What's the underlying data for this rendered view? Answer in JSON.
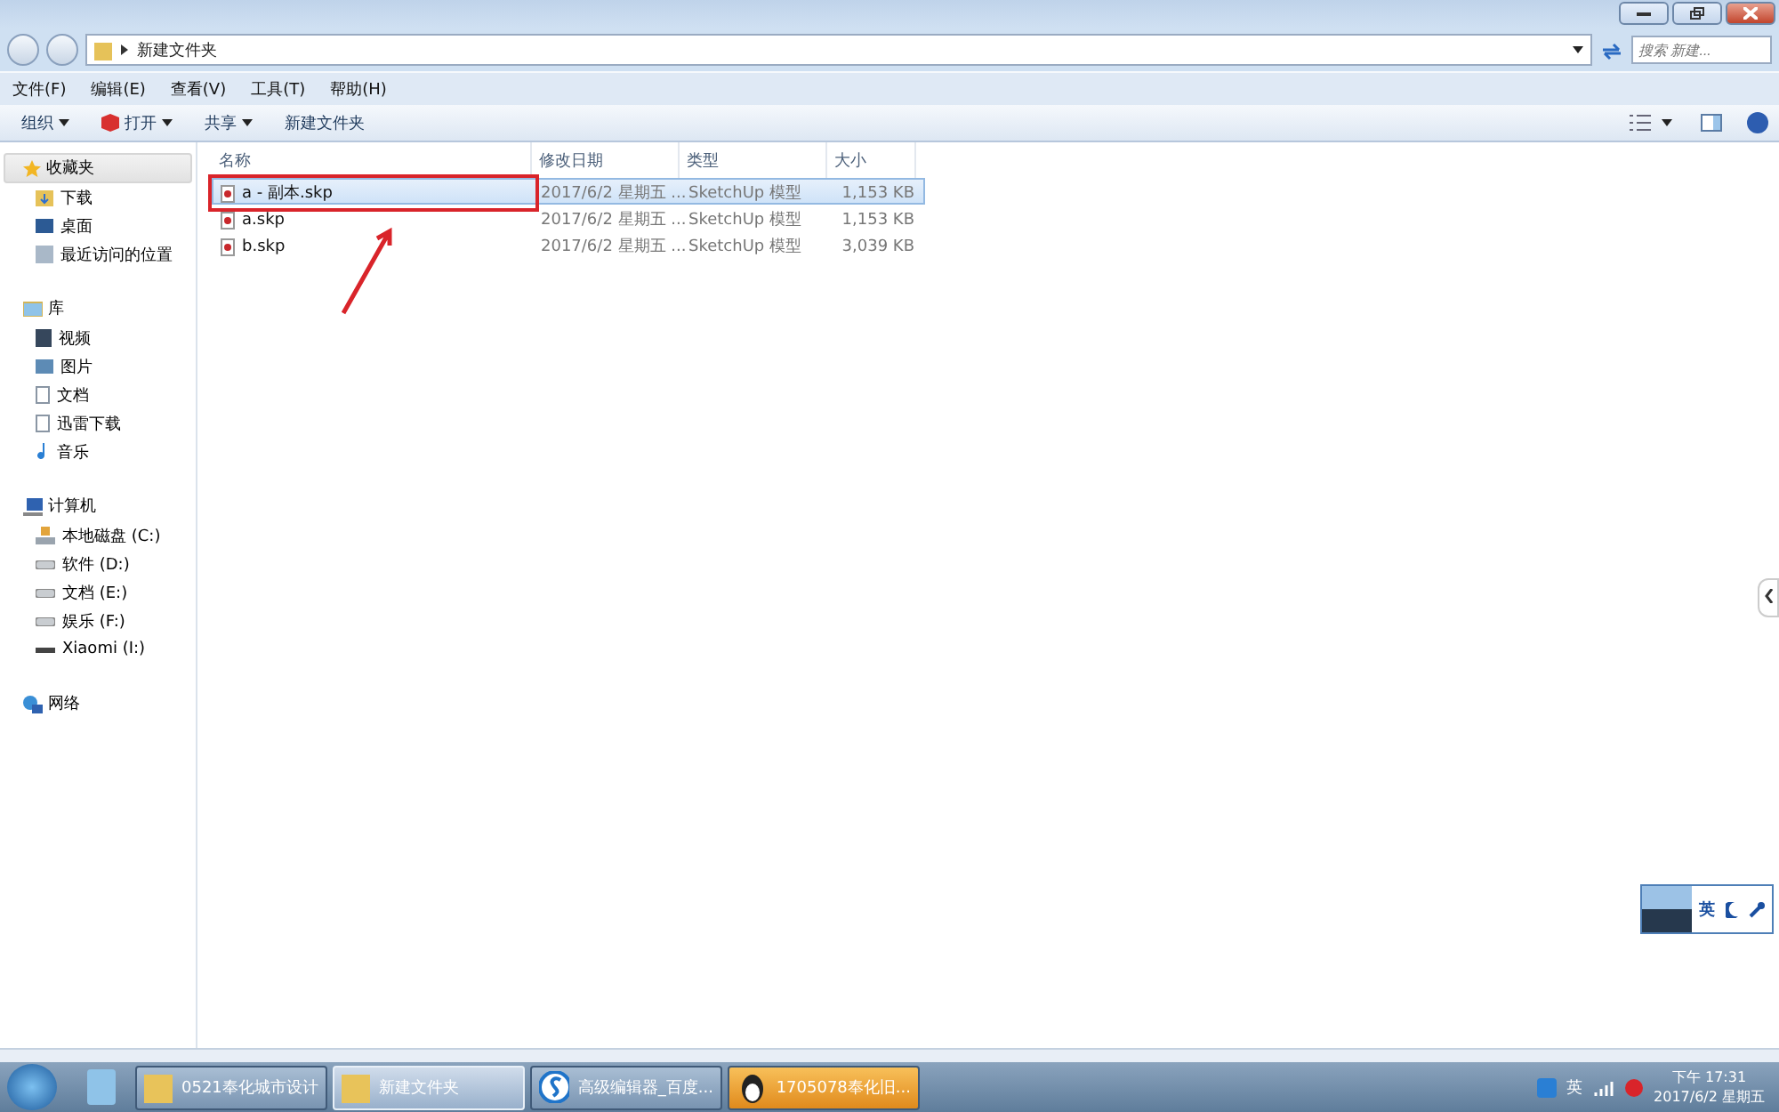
{
  "address_bar": {
    "path": "新建文件夹",
    "search_placeholder": "搜索 新建..."
  },
  "menu": [
    "文件(F)",
    "编辑(E)",
    "查看(V)",
    "工具(T)",
    "帮助(H)"
  ],
  "toolbar": [
    {
      "label": "组织",
      "kind": "dropdown"
    },
    {
      "label": "打开",
      "kind": "open"
    },
    {
      "label": "共享",
      "kind": "dropdown"
    },
    {
      "label": "新建文件夹",
      "kind": "plain"
    }
  ],
  "sidebar": {
    "groups": [
      {
        "label": "收藏夹",
        "kind": "star",
        "selected": true,
        "children": [
          {
            "label": "下载",
            "kind": "download"
          },
          {
            "label": "桌面",
            "kind": "desktop"
          },
          {
            "label": "最近访问的位置",
            "kind": "recent"
          }
        ]
      },
      {
        "label": "库",
        "kind": "library",
        "selected": false,
        "children": [
          {
            "label": "视频",
            "kind": "video"
          },
          {
            "label": "图片",
            "kind": "picture"
          },
          {
            "label": "文档",
            "kind": "doc"
          },
          {
            "label": "迅雷下载",
            "kind": "doc"
          },
          {
            "label": "音乐",
            "kind": "music"
          }
        ]
      },
      {
        "label": "计算机",
        "kind": "computer",
        "selected": false,
        "children": [
          {
            "label": "本地磁盘 (C:)",
            "kind": "sysdrive"
          },
          {
            "label": "软件 (D:)",
            "kind": "drive"
          },
          {
            "label": "文档 (E:)",
            "kind": "drive"
          },
          {
            "label": "娱乐 (F:)",
            "kind": "drive"
          },
          {
            "label": "Xiaomi (I:)",
            "kind": "usb"
          }
        ]
      },
      {
        "label": "网络",
        "kind": "network",
        "selected": false
      }
    ]
  },
  "table": {
    "columns": [
      "名称",
      "修改日期",
      "类型",
      "大小"
    ],
    "rows": [
      {
        "name": "a - 副本.skp",
        "modified": "2017/6/2 星期五 ...",
        "type": "SketchUp 模型",
        "size": "1,153 KB",
        "selected": true,
        "highlighted": true
      },
      {
        "name": "a.skp",
        "modified": "2017/6/2 星期五 ...",
        "type": "SketchUp 模型",
        "size": "1,153 KB",
        "selected": false,
        "highlighted": false
      },
      {
        "name": "b.skp",
        "modified": "2017/6/2 星期五 ...",
        "type": "SketchUp 模型",
        "size": "3,039 KB",
        "selected": false,
        "highlighted": false
      }
    ]
  },
  "ime_bar": {
    "language": "英"
  },
  "taskbar": {
    "items": [
      {
        "label": "0521奉化城市设计",
        "kind": "folder",
        "selected": false
      },
      {
        "label": "新建文件夹",
        "kind": "folder",
        "selected": true
      },
      {
        "label": "高级编辑器_百度...",
        "kind": "browser",
        "selected": false
      },
      {
        "label": "1705078奉化旧...",
        "kind": "chat",
        "selected": false,
        "flashing": true
      }
    ],
    "ime": "英",
    "time": "下午 17:31",
    "date": "2017/6/2 星期五"
  }
}
